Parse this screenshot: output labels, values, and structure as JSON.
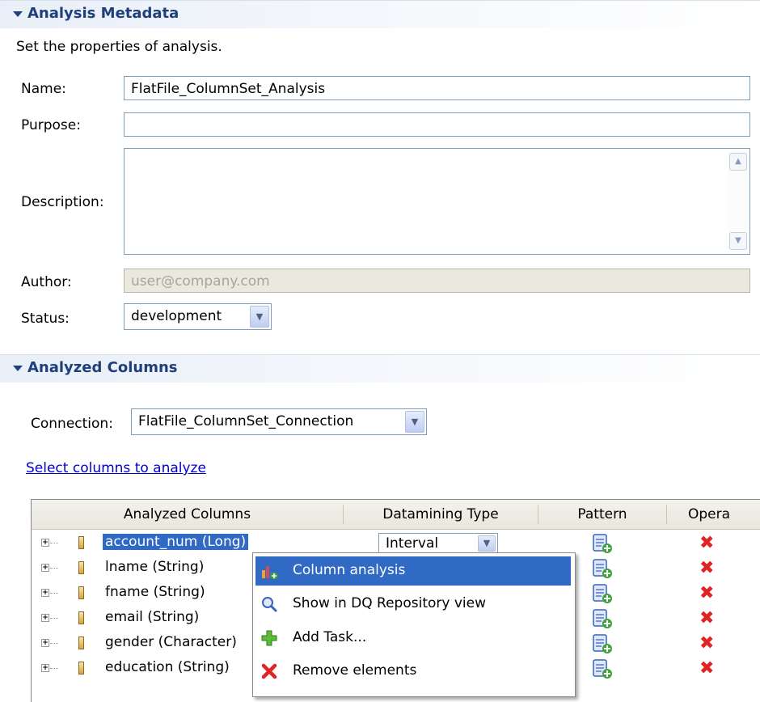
{
  "metadata": {
    "title": "Analysis Metadata",
    "description_text": "Set the properties of analysis.",
    "name_label": "Name:",
    "name_value": "FlatFile_ColumnSet_Analysis",
    "purpose_label": "Purpose:",
    "purpose_value": "",
    "description_label": "Description:",
    "author_label": "Author:",
    "author_value": "user@company.com",
    "status_label": "Status:",
    "status_value": "development"
  },
  "analyzed": {
    "title": "Analyzed Columns",
    "connection_label": "Connection:",
    "connection_value": "FlatFile_ColumnSet_Connection",
    "select_link": "Select columns to analyze",
    "headers": {
      "columns": "Analyzed Columns",
      "datamining": "Datamining Type",
      "pattern": "Pattern",
      "operation": "Opera"
    },
    "rows": [
      {
        "name": "account_num (Long)",
        "datamining": "Interval",
        "selected": true
      },
      {
        "name": "lname (String)"
      },
      {
        "name": "fname (String)"
      },
      {
        "name": "email (String)"
      },
      {
        "name": "gender (Character)"
      },
      {
        "name": "education (String)"
      }
    ]
  },
  "context_menu": {
    "items": [
      {
        "label": "Column analysis",
        "icon": "column-analysis-icon"
      },
      {
        "label": "Show in DQ Repository view",
        "icon": "magnifier-icon"
      },
      {
        "label": "Add Task...",
        "icon": "add-plus-icon"
      },
      {
        "label": "Remove elements",
        "icon": "remove-x-icon"
      }
    ]
  },
  "colors": {
    "section_title": "#1f3f7a",
    "selection": "#316ac5",
    "link": "#0000cc",
    "delete": "#e02424"
  }
}
